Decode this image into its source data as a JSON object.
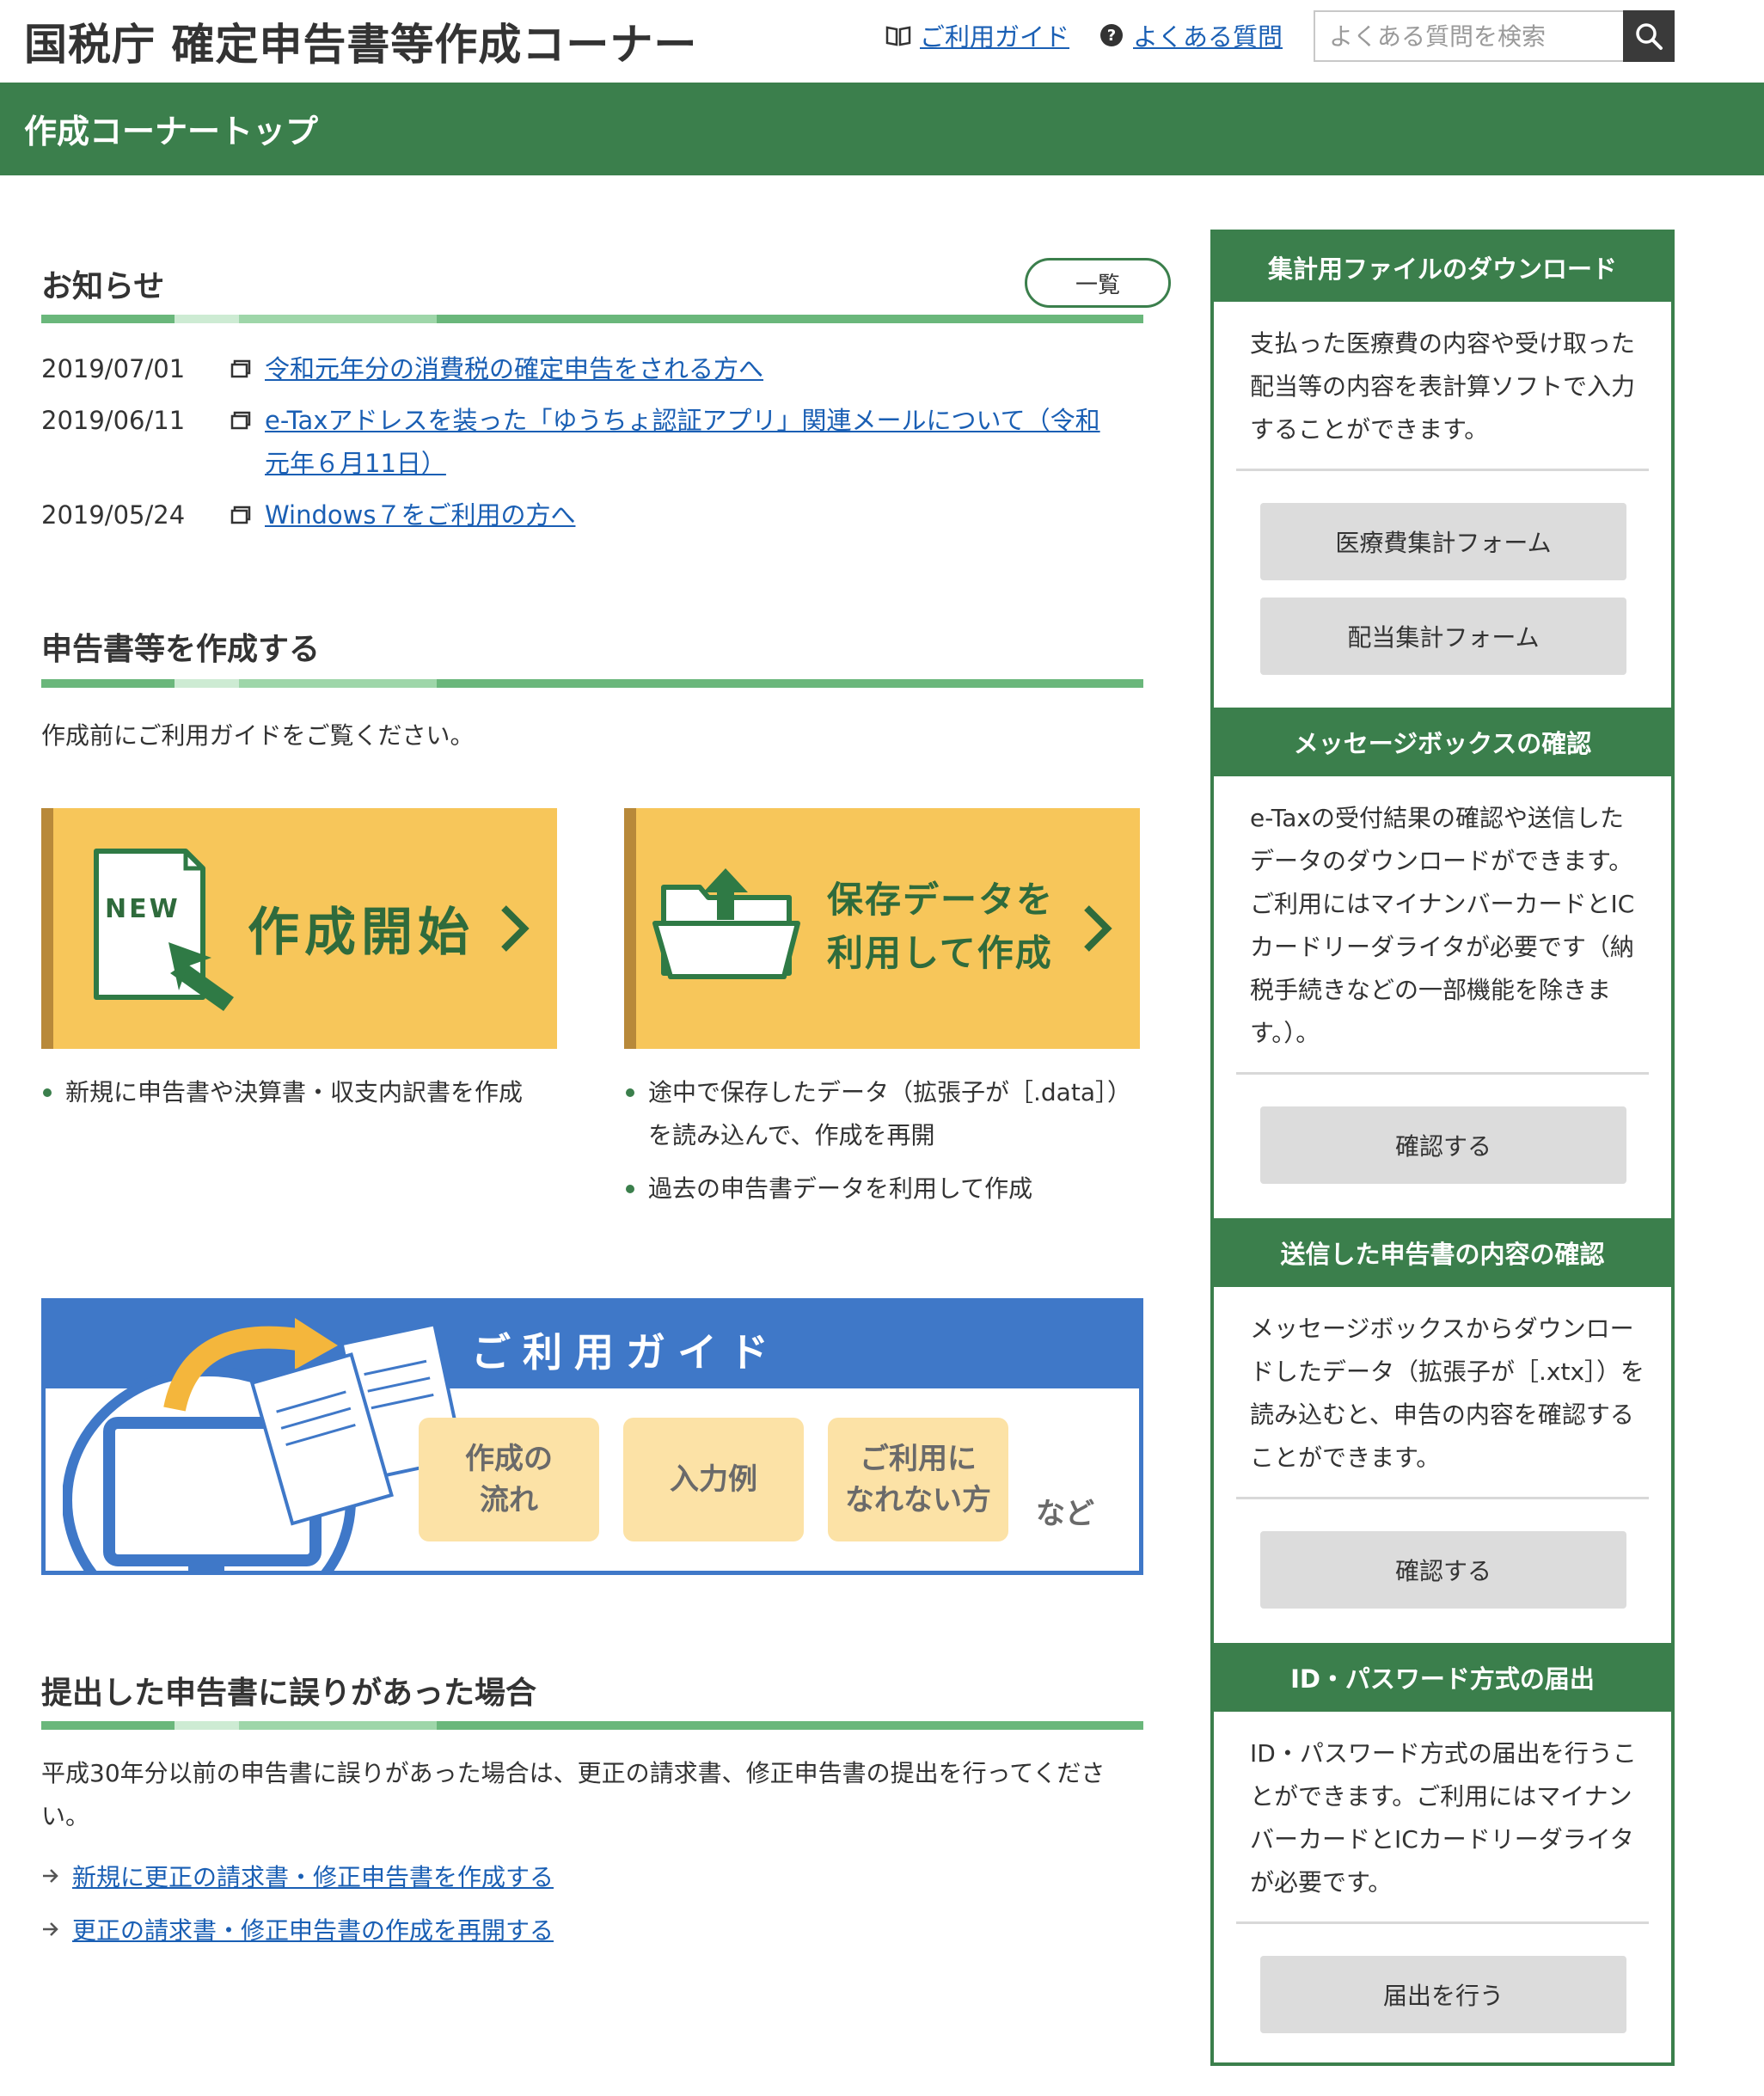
{
  "header": {
    "site_title": "国税庁 確定申告書等作成コーナー",
    "guide_link": "ご利用ガイド",
    "faq_link": "よくある質問",
    "search_placeholder": "よくある質問を検索"
  },
  "breadcrumb_bar": {
    "title": "作成コーナートップ"
  },
  "news": {
    "title": "お知らせ",
    "list_button": "一覧",
    "items": [
      {
        "date": "2019/07/01",
        "text": "令和元年分の消費税の確定申告をされる方へ"
      },
      {
        "date": "2019/06/11",
        "text": "e-Taxアドレスを装った「ゆうちょ認証アプリ」関連メールについて（令和元年６月11日）"
      },
      {
        "date": "2019/05/24",
        "text": "Windows７をご利用の方へ"
      }
    ]
  },
  "create": {
    "title": "申告書等を作成する",
    "lead": "作成前にご利用ガイドをご覧ください。",
    "new_badge": "NEW",
    "start_button": "作成開始",
    "saved_button_line1": "保存データを",
    "saved_button_line2": "利用して作成",
    "start_bullets": [
      "新規に申告書や決算書・収支内訳書を作成"
    ],
    "saved_bullets": [
      "途中で保存したデータ（拡張子が［.data］）を読み込んで、作成を再開",
      "過去の申告書データを利用して作成"
    ]
  },
  "guide_banner": {
    "title": "ご利用ガイド",
    "tiles": [
      {
        "line1": "作成の",
        "line2": "流れ"
      },
      {
        "line1": "入力例",
        "line2": ""
      },
      {
        "line1": "ご利用に",
        "line2": "なれない方"
      }
    ],
    "etc": "など"
  },
  "correction": {
    "title": "提出した申告書に誤りがあった場合",
    "text": "平成30年分以前の申告書に誤りがあった場合は、更正の請求書、修正申告書の提出を行ってください。",
    "links": [
      "新規に更正の請求書・修正申告書を作成する",
      "更正の請求書・修正申告書の作成を再開する"
    ]
  },
  "sidebar": {
    "sections": [
      {
        "title": "集計用ファイルのダウンロード",
        "text": "支払った医療費の内容や受け取った配当等の内容を表計算ソフトで入力することができます。",
        "buttons": [
          "医療費集計フォーム",
          "配当集計フォーム"
        ]
      },
      {
        "title": "メッセージボックスの確認",
        "text": "e-Taxの受付結果の確認や送信したデータのダウンロードができます。ご利用にはマイナンバーカードとICカードリーダライタが必要です（納税手続きなどの一部機能を除きます。）。",
        "buttons": [
          "確認する"
        ]
      },
      {
        "title": "送信した申告書の内容の確認",
        "text": "メッセージボックスからダウンロードしたデータ（拡張子が［.xtx］）を読み込むと、申告の内容を確認することができます。",
        "buttons": [
          "確認する"
        ]
      },
      {
        "title": "ID・パスワード方式の届出",
        "text": "ID・パスワード方式の届出を行うことができます。ご利用にはマイナンバーカードとICカードリーダライタが必要です。",
        "buttons": [
          "届出を行う"
        ]
      }
    ]
  },
  "colors": {
    "brand_green": "#3b7f4c",
    "button_yellow": "#f7c65a",
    "guide_blue": "#3f78c8",
    "link_blue": "#1a5fb4"
  }
}
